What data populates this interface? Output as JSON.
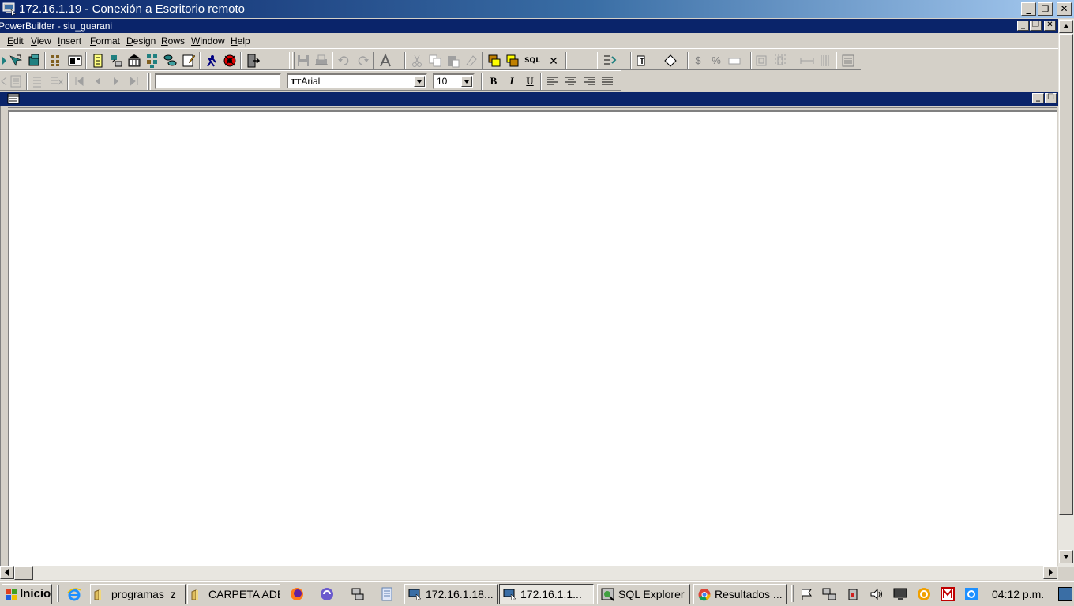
{
  "rdp_window": {
    "title": "172.16.1.19 - Conexión a Escritorio remoto",
    "controls": {
      "minimize": "_",
      "restore": "❐",
      "close": "✕"
    }
  },
  "pb_window": {
    "title": "PowerBuilder - siu_guarani"
  },
  "menu": [
    {
      "label": "Edit",
      "key": "E",
      "rest": "dit"
    },
    {
      "label": "View",
      "key": "V",
      "rest": "iew"
    },
    {
      "label": "Insert",
      "key": "I",
      "rest": "nsert"
    },
    {
      "label": "Format",
      "key": "F",
      "rest": "ormat"
    },
    {
      "label": "Design",
      "key": "D",
      "rest": "esign"
    },
    {
      "label": "Rows",
      "key": "R",
      "rest": "ows"
    },
    {
      "label": "Window",
      "key": "W",
      "rest": "indow"
    },
    {
      "label": "Help",
      "key": "H",
      "rest": "elp"
    }
  ],
  "toolbar2": {
    "text_field_value": "",
    "font_name": "Arial",
    "font_size": "10",
    "bold": "B",
    "italic": "I",
    "underline": "U"
  },
  "toolbar1": {
    "sql_label": "SQL",
    "close_label": "✕",
    "currency_label": "$",
    "percent_label": "%"
  },
  "taskbar": {
    "start_label": "Inicio",
    "tasks": [
      {
        "label": "programas_z"
      },
      {
        "label": "CARPETA ADB"
      },
      {
        "label": "172.16.1.18..."
      },
      {
        "label": "172.16.1.1..."
      },
      {
        "label": "SQL Explorer"
      },
      {
        "label": "Resultados ..."
      }
    ],
    "clock": "04:12 p.m."
  },
  "colors": {
    "title_dark": "#0a246a",
    "face": "#d4d0c8"
  }
}
